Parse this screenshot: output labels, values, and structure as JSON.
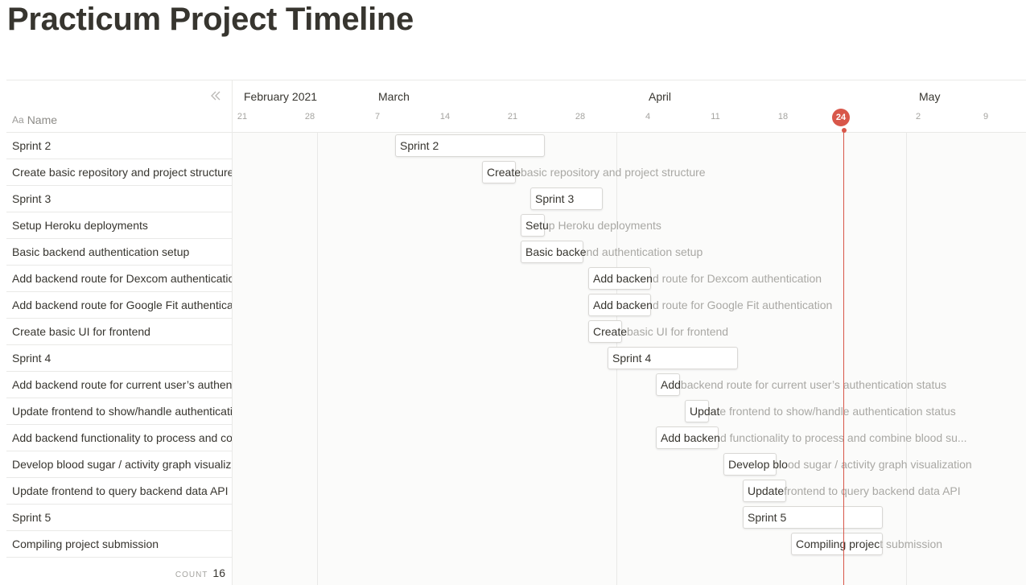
{
  "page": {
    "title": "Practicum Project Timeline"
  },
  "table": {
    "name_header": "Name",
    "name_header_icon": "Aa",
    "count_label": "COUNT",
    "count_value": "16",
    "rows": [
      "Sprint 2",
      "Create basic repository and project structure",
      "Sprint 3",
      "Setup Heroku deployments",
      "Basic backend authentication setup",
      "Add backend route for Dexcom authentication",
      "Add backend route for Google Fit authentication",
      "Create basic UI for frontend",
      "Sprint 4",
      "Add backend route for current user’s authentication status",
      "Update frontend to show/handle authentication status",
      "Add backend functionality to process and combine blood su...",
      "Develop blood sugar / activity graph visualization",
      "Update frontend to query backend data API",
      "Sprint 5",
      "Compiling project submission"
    ]
  },
  "timeline": {
    "months": [
      "February 2021",
      "March",
      "April",
      "May"
    ],
    "days": [
      "21",
      "28",
      "7",
      "14",
      "21",
      "28",
      "4",
      "11",
      "18",
      "2",
      "9"
    ],
    "today": "24",
    "today_color": "#d8574a",
    "bars": [
      {
        "start": "2021-03-09",
        "end": "2021-03-24",
        "inside": "Sprint 2",
        "after": ""
      },
      {
        "start": "2021-03-18",
        "end": "2021-03-21",
        "inside": "Create",
        "after": " basic repository and project structure"
      },
      {
        "start": "2021-03-23",
        "end": "2021-03-30",
        "inside": "Sprint 3",
        "after": ""
      },
      {
        "start": "2021-03-22",
        "end": "2021-03-24",
        "inside": "Setu",
        "after": "p Heroku deployments"
      },
      {
        "start": "2021-03-22",
        "end": "2021-03-28",
        "inside": "Basic backe",
        "after": "nd authentication setup"
      },
      {
        "start": "2021-03-29",
        "end": "2021-04-04",
        "inside": "Add backen",
        "after": "d route for Dexcom authentication"
      },
      {
        "start": "2021-03-29",
        "end": "2021-04-04",
        "inside": "Add backen",
        "after": "d route for Google Fit authentication"
      },
      {
        "start": "2021-03-29",
        "end": "2021-04-01",
        "inside": "Create",
        "after": " basic UI for frontend"
      },
      {
        "start": "2021-03-31",
        "end": "2021-04-13",
        "inside": "Sprint 4",
        "after": ""
      },
      {
        "start": "2021-04-05",
        "end": "2021-04-07",
        "inside": "Add",
        "after": " backend route for current user’s authentication status"
      },
      {
        "start": "2021-04-08",
        "end": "2021-04-10",
        "inside": "Updat",
        "after": "e frontend to show/handle authentication status"
      },
      {
        "start": "2021-04-05",
        "end": "2021-04-11",
        "inside": "Add backen",
        "after": "d functionality to process and combine blood su..."
      },
      {
        "start": "2021-04-12",
        "end": "2021-04-17",
        "inside": "Develop blo",
        "after": "od sugar / activity graph visualization"
      },
      {
        "start": "2021-04-14",
        "end": "2021-04-18",
        "inside": "Update",
        "after": " frontend to query backend data API"
      },
      {
        "start": "2021-04-14",
        "end": "2021-04-28",
        "inside": "Sprint 5",
        "after": ""
      },
      {
        "start": "2021-04-19",
        "end": "2021-04-28",
        "inside": "Compiling projec",
        "after": "t submission"
      }
    ]
  }
}
